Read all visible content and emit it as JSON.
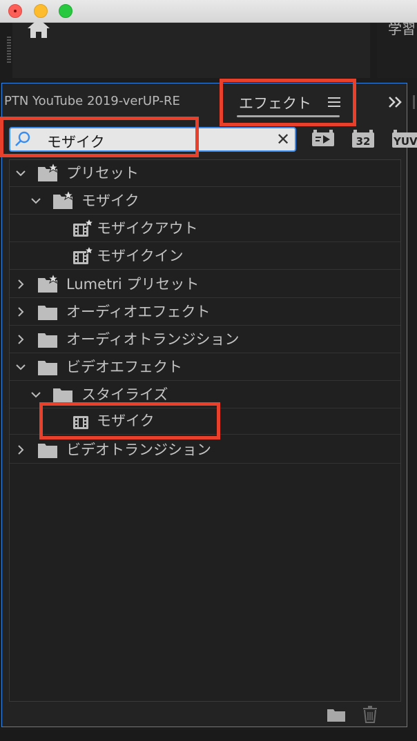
{
  "window": {
    "controls": [
      "close",
      "minimize",
      "zoom"
    ]
  },
  "header": {
    "home_icon": "home-icon",
    "learn_tab_label": "学習"
  },
  "panel": {
    "project_tab_label": "PTN YouTube 2019-verUP-RE",
    "effects_tab_label": "エフェクト",
    "menu_icon": "hamburger-icon",
    "overflow_icon": "double-chevron-right-icon"
  },
  "search": {
    "value": "モザイク",
    "icon": "search-icon",
    "clear_icon": "close-icon"
  },
  "toolbar": {
    "accel_icon": "accelerated-effects-icon",
    "bit32_label": "32",
    "yuv_label": "YUV"
  },
  "tree": {
    "rows": [
      {
        "label": "プリセット",
        "expanded": true,
        "icon": "preset-folder-icon"
      },
      {
        "label": "モザイク",
        "expanded": true,
        "icon": "preset-folder-icon"
      },
      {
        "label": "モザイクアウト",
        "icon": "preset-effect-icon"
      },
      {
        "label": "モザイクイン",
        "icon": "preset-effect-icon"
      },
      {
        "label": "Lumetri プリセット",
        "expanded": false,
        "icon": "preset-folder-icon"
      },
      {
        "label": "オーディオエフェクト",
        "expanded": false,
        "icon": "folder-icon"
      },
      {
        "label": "オーディオトランジション",
        "expanded": false,
        "icon": "folder-icon"
      },
      {
        "label": "ビデオエフェクト",
        "expanded": true,
        "icon": "folder-icon"
      },
      {
        "label": "スタイライズ",
        "expanded": true,
        "icon": "folder-icon"
      },
      {
        "label": "モザイク",
        "icon": "effect-icon"
      },
      {
        "label": "ビデオトランジション",
        "expanded": false,
        "icon": "folder-icon"
      }
    ]
  },
  "footer": {
    "new_bin_icon": "new-bin-icon",
    "delete_icon": "trash-icon"
  },
  "colors": {
    "highlight": "#e8402a",
    "focus": "#2f86e8",
    "panel_bg": "#232323"
  }
}
